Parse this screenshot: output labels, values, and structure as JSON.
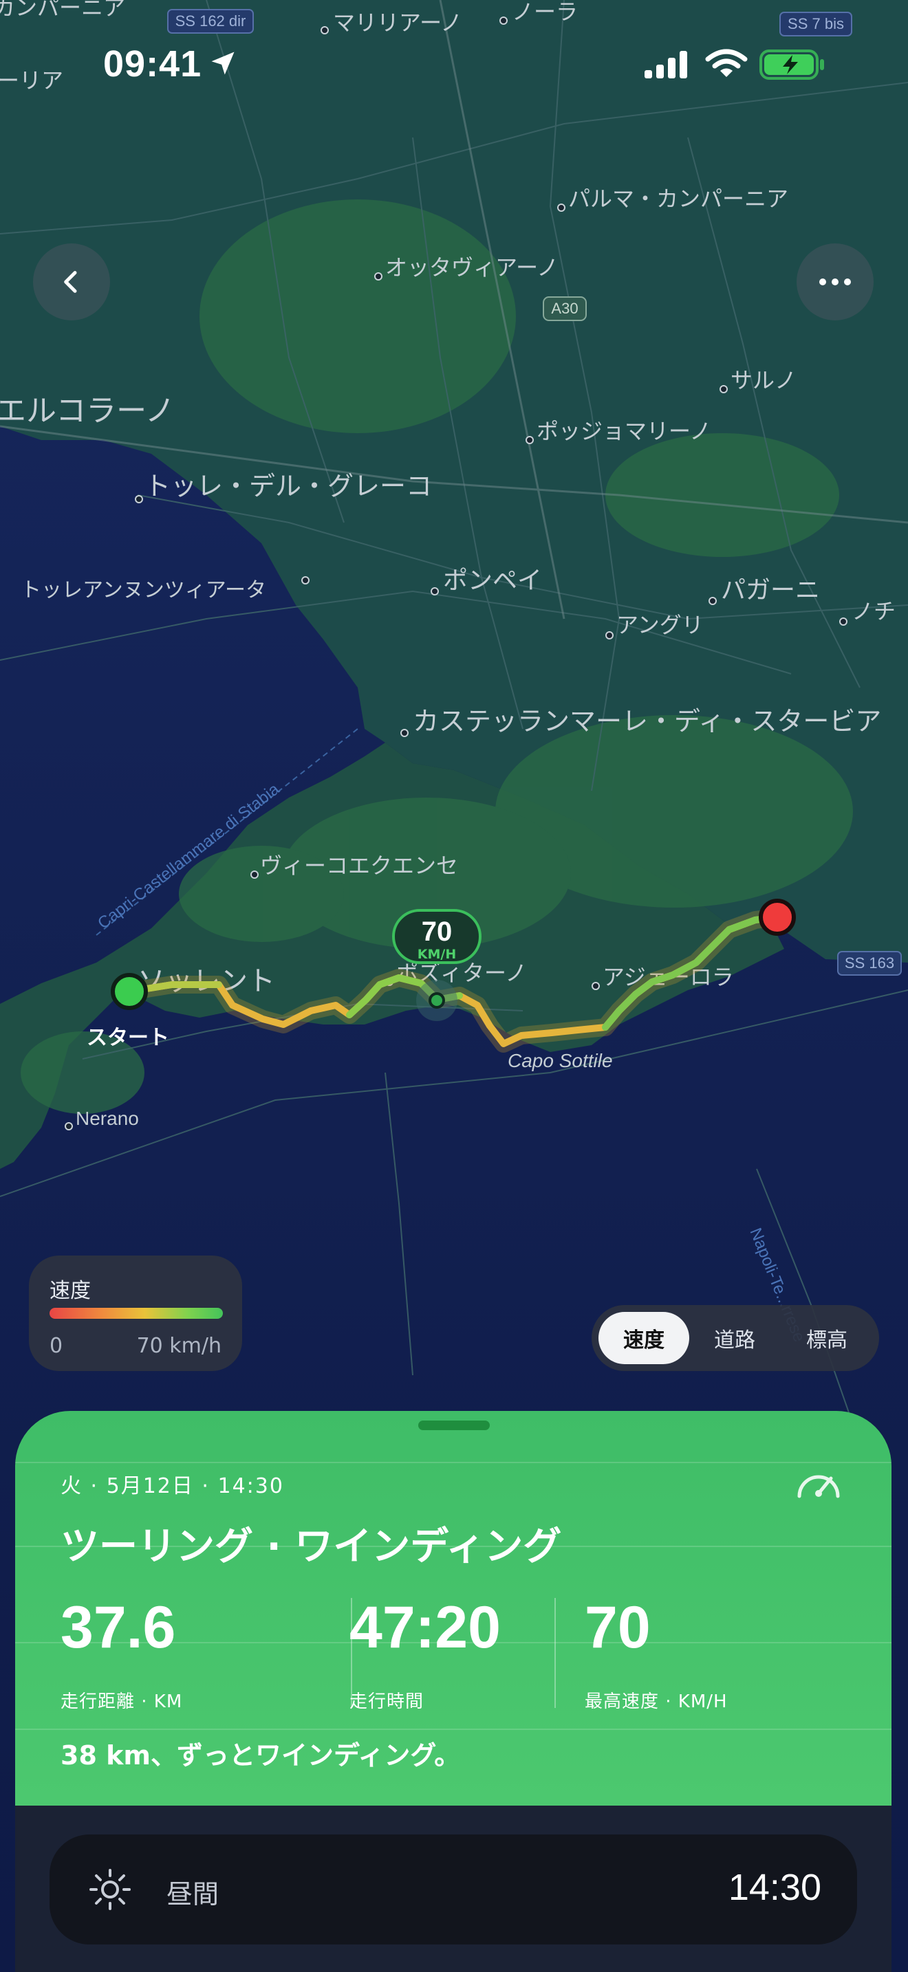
{
  "status_bar": {
    "time": "09:41"
  },
  "map": {
    "labels": {
      "campania_top": "カンパーニア",
      "aria": "ーリア",
      "ss162": "SS 162 dir",
      "mariliano": "マリリアーノ",
      "nola": "ノーラ",
      "ss7": "SS 7 bis",
      "palma": "パルマ・カンパーニア",
      "ottaviano": "オッタヴィアーノ",
      "a30": "A30",
      "sarno": "サルノ",
      "ercolano": "エルコラーノ",
      "poggiomarino": "ポッジョマリーノ",
      "torre_greco": "トッレ・デル・グレーコ",
      "torre_annunziata": "トッレアンヌンツィアータ",
      "pompei": "ポンペイ",
      "pagani": "パガーニ",
      "angri": "アングリ",
      "nocera": "ノチ",
      "castellammare": "カステッランマーレ・ディ・スタービア",
      "ferry": "Capri-Castellammare di Stabia",
      "vico": "ヴィーコエクエンセ",
      "sorrento": "ソッレント",
      "positano": "ポズィターノ",
      "agerola": "アジェーロラ",
      "ss163": "SS 163",
      "capo": "Capo Sottile",
      "nerano": "Nerano",
      "napoli": "Napoli-Te...rrese"
    },
    "start_label": "スタート",
    "speed_bubble": {
      "value": "70",
      "unit": "KM/H"
    },
    "route_colors": {
      "slow": "#e9b73a",
      "mid": "#b7d043",
      "fast": "#5cc84f"
    },
    "start_color": "#3bcc4f",
    "end_color": "#ef3b3b"
  },
  "legend": {
    "title": "速度",
    "min": "0",
    "max": "70 km/h"
  },
  "segmented": {
    "items": [
      "速度",
      "道路",
      "標高"
    ],
    "selected": "速度"
  },
  "ride": {
    "date": "火 · 5月12日 · 14:30",
    "title": "ツーリング · ワインディング",
    "stats": [
      {
        "value": "37.6",
        "label": "走行距離 · KM"
      },
      {
        "value": "47:20",
        "label": "走行時間"
      },
      {
        "value": "70",
        "label": "最高速度 · KM/H"
      }
    ],
    "description": "38 km、ずっとワインディング。",
    "accent": "#47c46c"
  },
  "daylight": {
    "label": "昼間",
    "time": "14:30"
  }
}
